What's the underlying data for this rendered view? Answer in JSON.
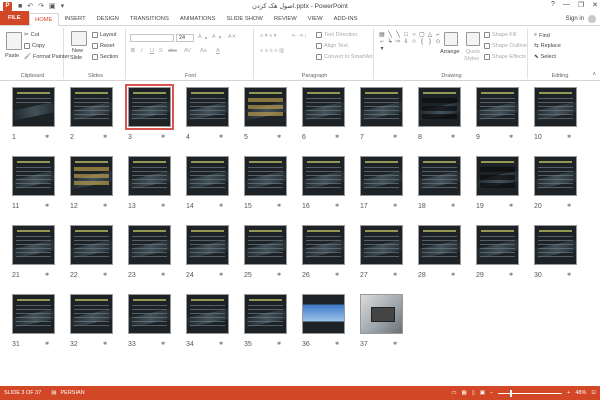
{
  "window": {
    "title": "اصول هک کردن.pptx - PowerPoint",
    "app_icon": "P",
    "controls": [
      "?",
      "—",
      "❐",
      "✕"
    ]
  },
  "tabs": [
    "FILE",
    "HOME",
    "INSERT",
    "DESIGN",
    "TRANSITIONS",
    "ANIMATIONS",
    "SLIDE SHOW",
    "REVIEW",
    "VIEW",
    "ADD-INS"
  ],
  "active_tab": "HOME",
  "account": {
    "label": "Sign in"
  },
  "ribbon": {
    "clipboard": {
      "paste": "Paste",
      "cut": "Cut",
      "copy": "Copy",
      "format_painter": "Format Painter",
      "label": "Clipboard"
    },
    "slides": {
      "new_slide": "New",
      "new_slide_2": "Slide",
      "layout": "Layout",
      "reset": "Reset",
      "section": "Section",
      "label": "Slides"
    },
    "font": {
      "font_name": "",
      "font_size": "24",
      "label": "Font",
      "bold": "B",
      "italic": "I",
      "underline": "U",
      "strike": "S",
      "shadow": "abc",
      "spacing": "AV",
      "case": "Aa",
      "color": "A"
    },
    "paragraph": {
      "text_direction": "Text Direction",
      "align_text": "Align Text",
      "convert_smartart": "Convert to SmartArt",
      "label": "Paragraph"
    },
    "drawing": {
      "arrange": "Arrange",
      "quick_styles_1": "Quick",
      "quick_styles_2": "Styles",
      "shape_fill": "Shape Fill",
      "shape_outline": "Shape Outline",
      "shape_effects": "Shape Effects",
      "label": "Drawing"
    },
    "editing": {
      "find": "Find",
      "replace": "Replace",
      "select": "Select",
      "label": "Editing"
    }
  },
  "slides": [
    {
      "n": "1",
      "kind": "title"
    },
    {
      "n": "2",
      "kind": "text"
    },
    {
      "n": "3",
      "kind": "text",
      "selected": true
    },
    {
      "n": "4",
      "kind": "text"
    },
    {
      "n": "5",
      "kind": "table"
    },
    {
      "n": "6",
      "kind": "text"
    },
    {
      "n": "7",
      "kind": "text"
    },
    {
      "n": "8",
      "kind": "screen"
    },
    {
      "n": "9",
      "kind": "text"
    },
    {
      "n": "10",
      "kind": "text"
    },
    {
      "n": "11",
      "kind": "text"
    },
    {
      "n": "12",
      "kind": "table"
    },
    {
      "n": "13",
      "kind": "text"
    },
    {
      "n": "14",
      "kind": "text"
    },
    {
      "n": "15",
      "kind": "text"
    },
    {
      "n": "16",
      "kind": "text"
    },
    {
      "n": "17",
      "kind": "text"
    },
    {
      "n": "18",
      "kind": "text"
    },
    {
      "n": "19",
      "kind": "screen"
    },
    {
      "n": "20",
      "kind": "text"
    },
    {
      "n": "21",
      "kind": "text"
    },
    {
      "n": "22",
      "kind": "text"
    },
    {
      "n": "23",
      "kind": "text"
    },
    {
      "n": "24",
      "kind": "text"
    },
    {
      "n": "25",
      "kind": "text"
    },
    {
      "n": "26",
      "kind": "text"
    },
    {
      "n": "27",
      "kind": "text"
    },
    {
      "n": "28",
      "kind": "text"
    },
    {
      "n": "29",
      "kind": "text"
    },
    {
      "n": "30",
      "kind": "text"
    },
    {
      "n": "31",
      "kind": "text"
    },
    {
      "n": "32",
      "kind": "text"
    },
    {
      "n": "33",
      "kind": "text"
    },
    {
      "n": "34",
      "kind": "text"
    },
    {
      "n": "35",
      "kind": "text"
    },
    {
      "n": "36",
      "kind": "blue"
    },
    {
      "n": "37",
      "kind": "photo"
    }
  ],
  "status": {
    "slide_counter": "SLIDE 3 OF 37",
    "language": "PERSIAN",
    "zoom": "48%"
  }
}
